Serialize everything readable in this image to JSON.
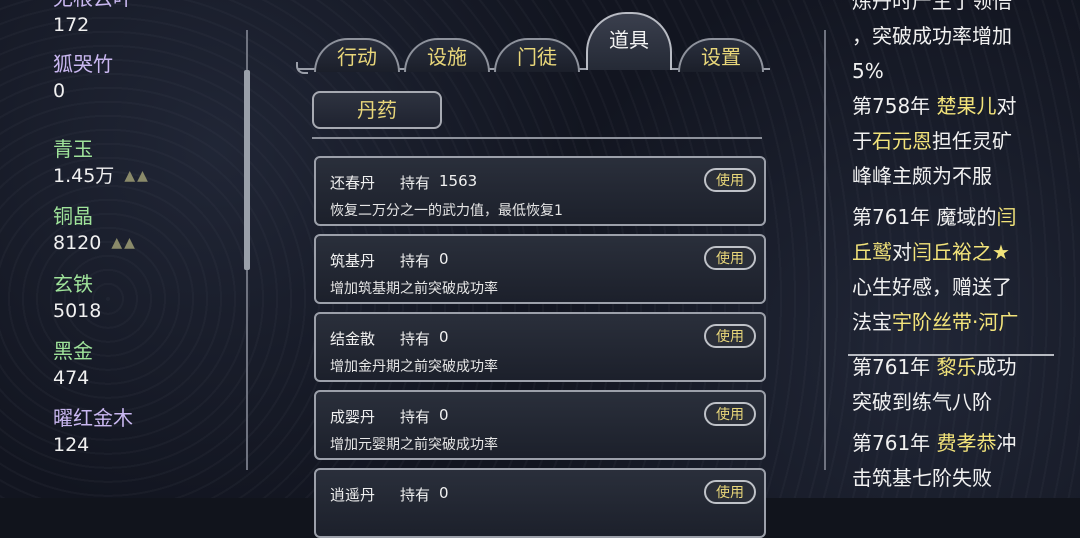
{
  "resources": [
    {
      "name": "无根云叶",
      "value": "172",
      "color": "#c9b7f0",
      "arrows": ""
    },
    {
      "name": "狐哭竹",
      "value": "0",
      "color": "#c9b7f0",
      "arrows": ""
    },
    {
      "name": "青玉",
      "value": "1.45万",
      "color": "#9fe39a",
      "arrows": "▲▲"
    },
    {
      "name": "铜晶",
      "value": "8120",
      "color": "#9fe39a",
      "arrows": "▲▲"
    },
    {
      "name": "玄铁",
      "value": "5018",
      "color": "#9fe39a",
      "arrows": ""
    },
    {
      "name": "黑金",
      "value": "474",
      "color": "#9fe39a",
      "arrows": ""
    },
    {
      "name": "曜红金木",
      "value": "124",
      "color": "#c9b7f0",
      "arrows": ""
    }
  ],
  "tabs": [
    "行动",
    "设施",
    "门徒",
    "道具",
    "设置"
  ],
  "active_tab": "道具",
  "subtab": "丹药",
  "hold_label": "持有",
  "use_label": "使用",
  "items": [
    {
      "name": "还春丹",
      "count": "1563",
      "desc": "恢复二万分之一的武力值，最低恢复1"
    },
    {
      "name": "筑基丹",
      "count": "0",
      "desc": "增加筑基期之前突破成功率"
    },
    {
      "name": "结金散",
      "count": "0",
      "desc": "增加金丹期之前突破成功率"
    },
    {
      "name": "成婴丹",
      "count": "0",
      "desc": "增加元婴期之前突破成功率"
    },
    {
      "name": "逍遥丹",
      "count": "0",
      "desc": ""
    }
  ],
  "log": {
    "entry0": {
      "l1": "炼丹时产生了领悟",
      "l2": "，突破成功率增加",
      "l3": "5%"
    },
    "entry1": {
      "year": "第758年",
      "name1": "楚果儿",
      "t1": "对",
      "t2": "于",
      "name2": "石元恩",
      "t3": "担任灵矿",
      "t4": "峰峰主颇为不服"
    },
    "entry2": {
      "year": "第761年",
      "t1": "魔域的",
      "name1a": "闫",
      "name1b": "丘鹫",
      "t2": "对",
      "name2": "闫丘裕之★",
      "t3": "心生好感，赠送了",
      "t4": "法宝",
      "item": "宇阶丝带·河广"
    },
    "entry3": {
      "year": "第761年",
      "name": "黎乐",
      "t1": "成功",
      "t2": "突破到练气八阶"
    },
    "entry4": {
      "year": "第761年",
      "name": "费孝恭",
      "t1": "冲",
      "t2": "击筑基七阶失败"
    }
  }
}
